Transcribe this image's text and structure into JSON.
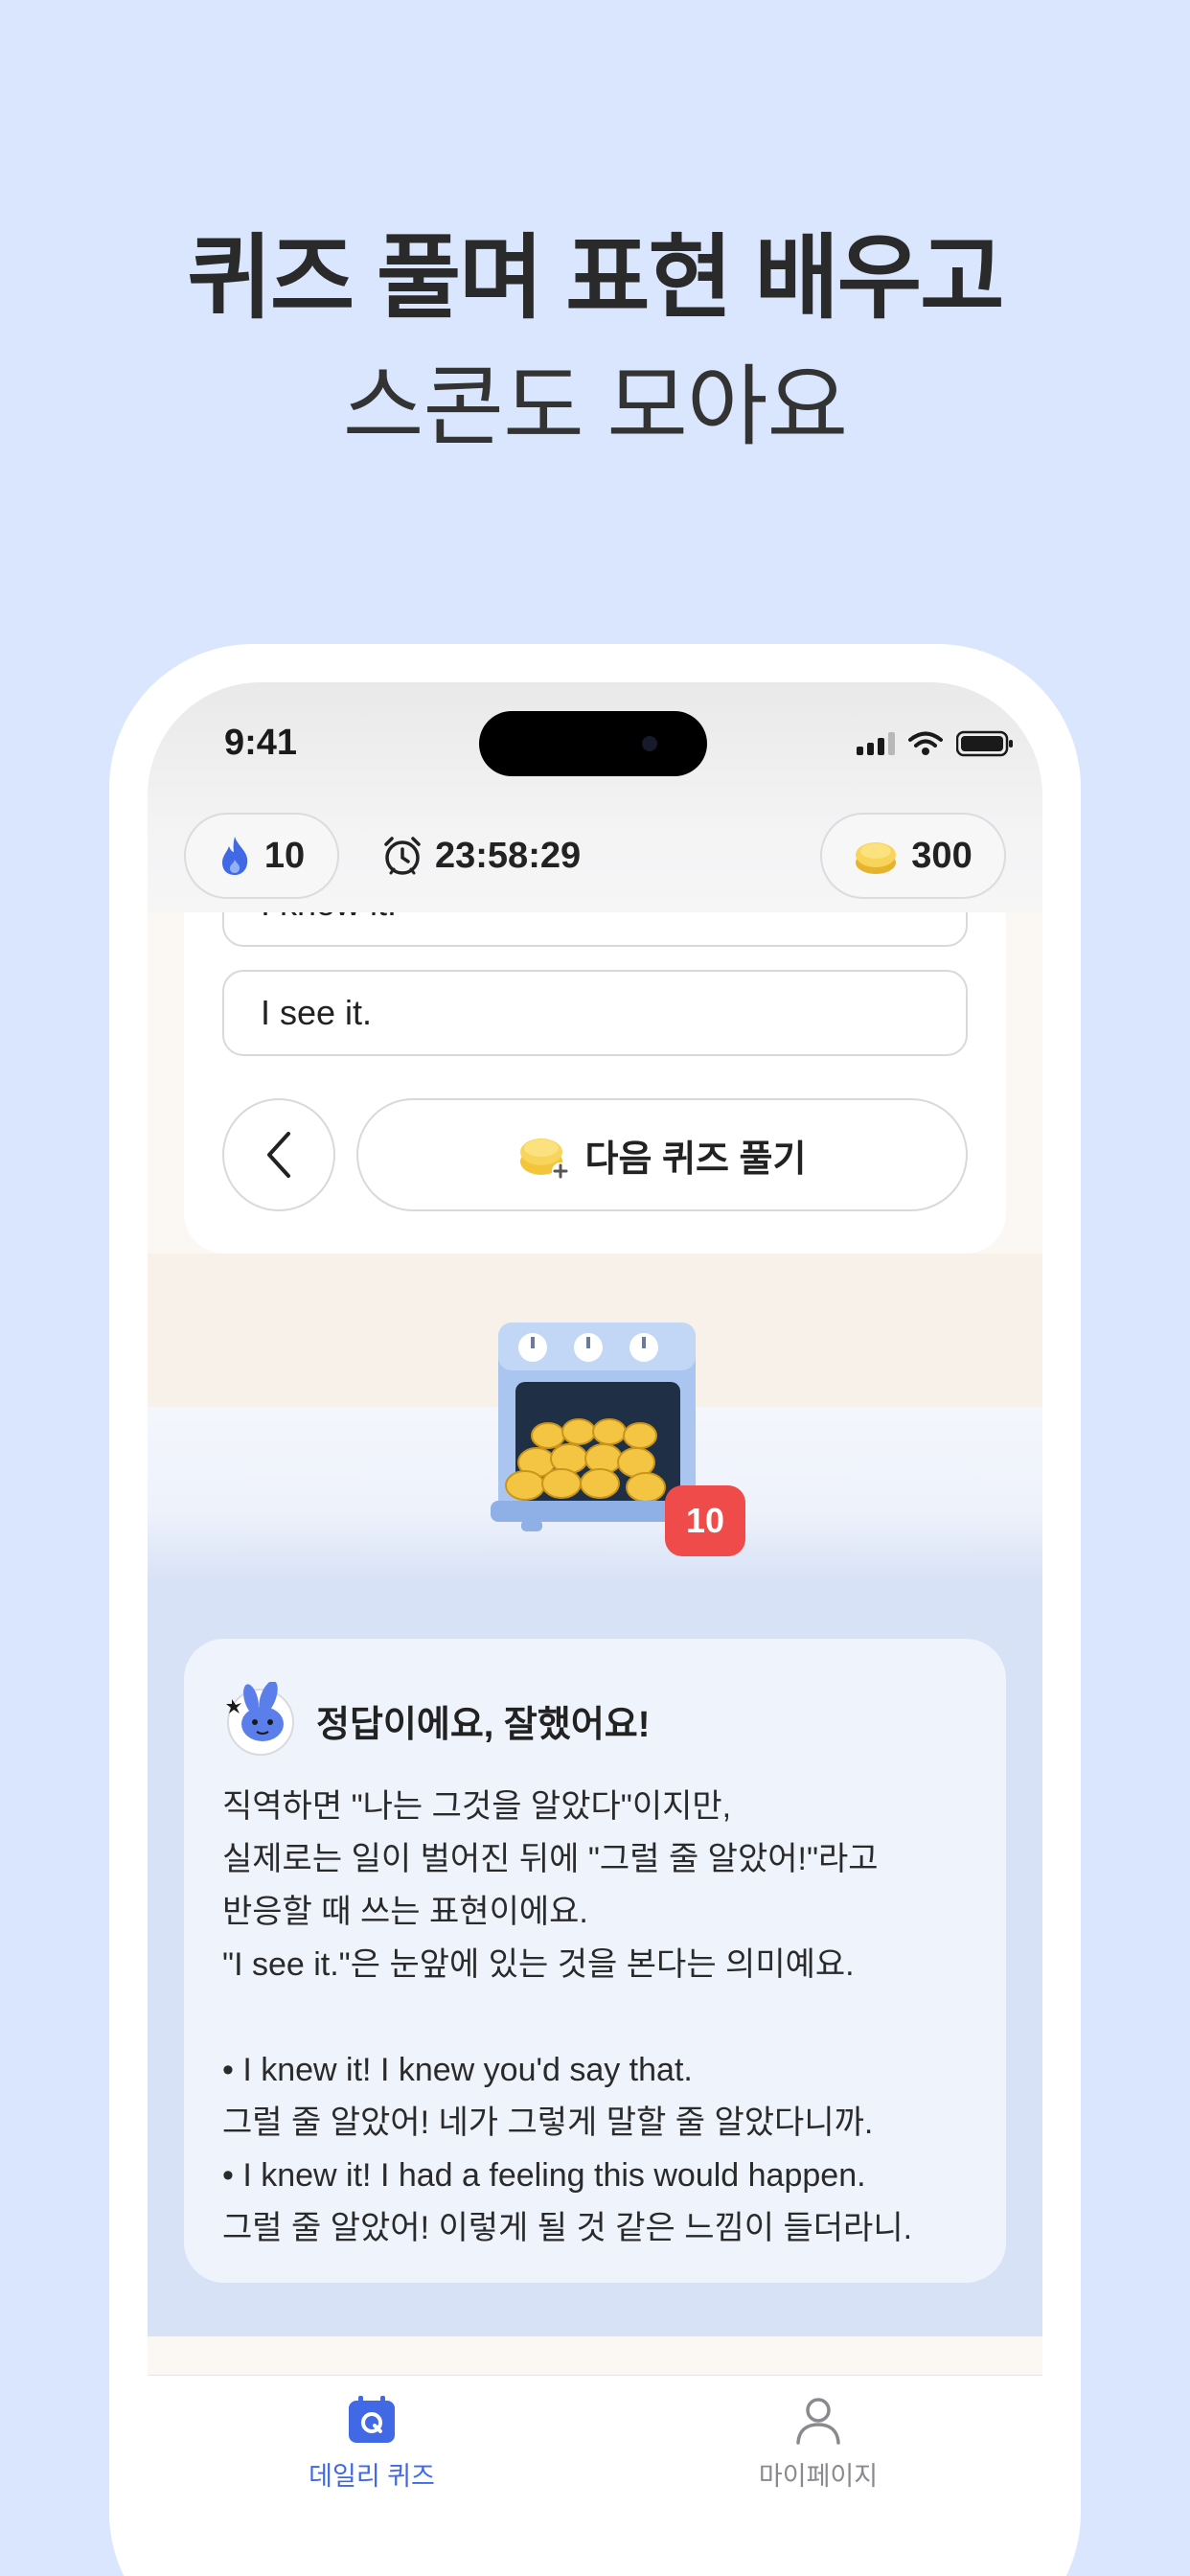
{
  "headline": {
    "line1": "퀴즈 풀며 표현 배우고",
    "line2": "스콘도 모아요"
  },
  "status_bar": {
    "time": "9:41"
  },
  "header": {
    "streak": "10",
    "timer": "23:58:29",
    "coins": "300"
  },
  "quiz": {
    "options": [
      "I know it.",
      "I see it."
    ],
    "next_label": "다음 퀴즈 풀기"
  },
  "oven": {
    "count": "10"
  },
  "explanation": {
    "title": "정답이에요, 잘했어요!",
    "body": "직역하면 \"나는 그것을 알았다\"이지만,\n실제로는 일이 벌어진 뒤에 \"그럴 줄 알았어!\"라고\n반응할 때 쓰는 표현이에요.\n\"I see it.\"은 눈앞에 있는 것을 본다는 의미예요.\n\n• I knew it! I knew you'd say that.\n그럴 줄 알았어! 네가 그렇게 말할 줄 알았다니까.\n• I knew it! I had a feeling this would happen.\n그럴 줄 알았어! 이렇게 될 것 같은 느낌이 들더라니."
  },
  "tabbar": {
    "tabs": [
      {
        "label": "데일리 퀴즈",
        "icon": "calendar-q-icon",
        "active": true
      },
      {
        "label": "마이페이지",
        "icon": "person-icon",
        "active": false
      }
    ]
  },
  "colors": {
    "background": "#dae6fd",
    "accent": "#4169e6",
    "badge": "#f04b4b"
  }
}
